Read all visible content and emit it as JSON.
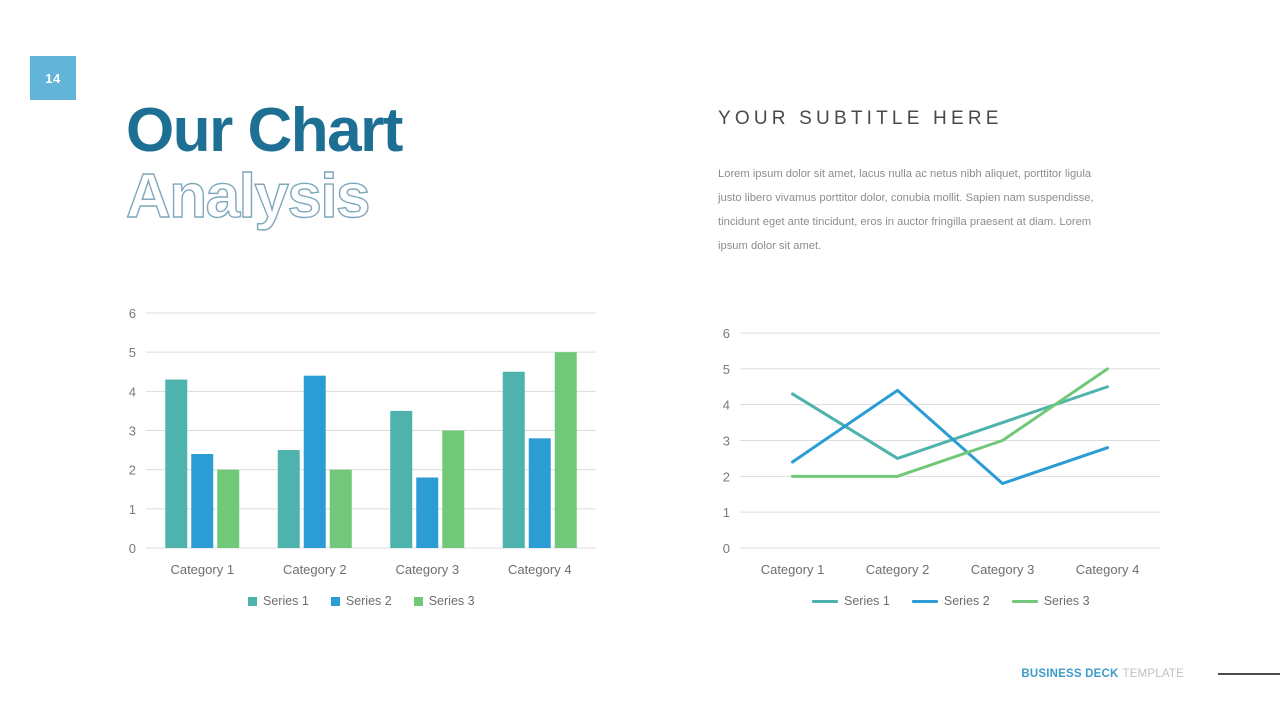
{
  "page": {
    "number": "14",
    "badge_color": "#62b4d8"
  },
  "title": {
    "line1": "Our Chart",
    "line2": "Analysis",
    "color_solid": "#1e6f94",
    "color_outline": "#7fa8bd"
  },
  "subtitle": {
    "heading": "YOUR SUBTITLE HERE",
    "body": "Lorem ipsum dolor sit amet, lacus nulla ac netus nibh aliquet, porttitor ligula justo libero vivamus porttitor dolor, conubia mollit. Sapien nam suspendisse, tincidunt eget ante tincidunt, eros in auctor fringilla praesent at diam. Lorem ipsum dolor sit amet."
  },
  "legend_bar": [
    {
      "label": "Series 1",
      "color": "#4eb3ac"
    },
    {
      "label": "Series 2",
      "color": "#2b9dd4"
    },
    {
      "label": "Series 3",
      "color": "#70c878"
    }
  ],
  "legend_line": [
    {
      "label": "Series 1",
      "color": "#4eb3ac"
    },
    {
      "label": "Series 2",
      "color": "#2b9dd4"
    },
    {
      "label": "Series 3",
      "color": "#70c878"
    }
  ],
  "footer": {
    "brand": "BUSINESS DECK",
    "template": "TEMPLATE",
    "brand_color": "#3d9bc8"
  },
  "chart_data": [
    {
      "type": "bar",
      "title": "",
      "xlabel": "",
      "ylabel": "",
      "categories": [
        "Category 1",
        "Category 2",
        "Category 3",
        "Category 4"
      ],
      "series": [
        {
          "name": "Series 1",
          "color": "#4eb3ac",
          "values": [
            4.3,
            2.5,
            3.5,
            4.5
          ]
        },
        {
          "name": "Series 2",
          "color": "#2b9dd4",
          "values": [
            2.4,
            4.4,
            1.8,
            2.8
          ]
        },
        {
          "name": "Series 3",
          "color": "#70c878",
          "values": [
            2,
            2,
            3,
            5
          ]
        }
      ],
      "ylim": [
        0,
        6
      ],
      "yticks": [
        0,
        1,
        2,
        3,
        4,
        5,
        6
      ],
      "grid": true,
      "legend_position": "bottom"
    },
    {
      "type": "line",
      "title": "",
      "xlabel": "",
      "ylabel": "",
      "categories": [
        "Category 1",
        "Category 2",
        "Category 3",
        "Category 4"
      ],
      "series": [
        {
          "name": "Series 1",
          "color": "#4eb3ac",
          "values": [
            4.3,
            2.5,
            3.5,
            4.5
          ]
        },
        {
          "name": "Series 2",
          "color": "#2b9dd4",
          "values": [
            2.4,
            4.4,
            1.8,
            2.8
          ]
        },
        {
          "name": "Series 3",
          "color": "#70c878",
          "values": [
            2,
            2,
            3,
            5
          ]
        }
      ],
      "ylim": [
        0,
        6
      ],
      "yticks": [
        0,
        1,
        2,
        3,
        4,
        5,
        6
      ],
      "grid": true,
      "legend_position": "bottom"
    }
  ]
}
